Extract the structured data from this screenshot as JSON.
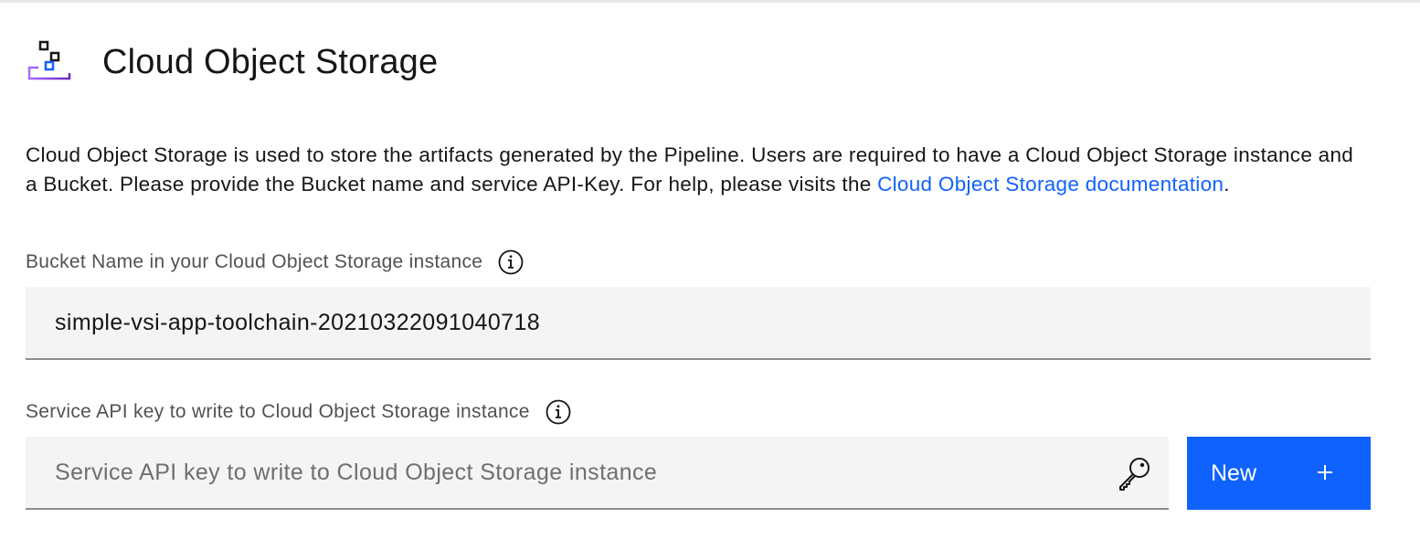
{
  "header": {
    "icon": "cloud-object-storage-icon",
    "title": "Cloud Object Storage"
  },
  "description": {
    "text": "Cloud Object Storage is used to store the artifacts generated by the Pipeline. Users are required to have a Cloud Object Storage instance and a Bucket. Please provide the Bucket name and service API-Key. For help, please visits the ",
    "link_text": "Cloud Object Storage documentation",
    "trailing": "."
  },
  "bucket": {
    "label": "Bucket Name in your Cloud Object Storage instance",
    "value": "simple-vsi-app-toolchain-20210322091040718",
    "info_icon": "info-icon"
  },
  "api_key": {
    "label": "Service API key to write to Cloud Object Storage instance",
    "placeholder": "Service API key to write to Cloud Object Storage instance",
    "value": "",
    "info_icon": "info-icon",
    "key_icon": "key-icon"
  },
  "new_button": {
    "label": "New",
    "icon": "plus-icon"
  },
  "colors": {
    "link": "#0f62fe",
    "button": "#0f62fe",
    "field_bg": "#f4f4f4",
    "field_border": "#8d8d8d",
    "label": "#525252"
  }
}
